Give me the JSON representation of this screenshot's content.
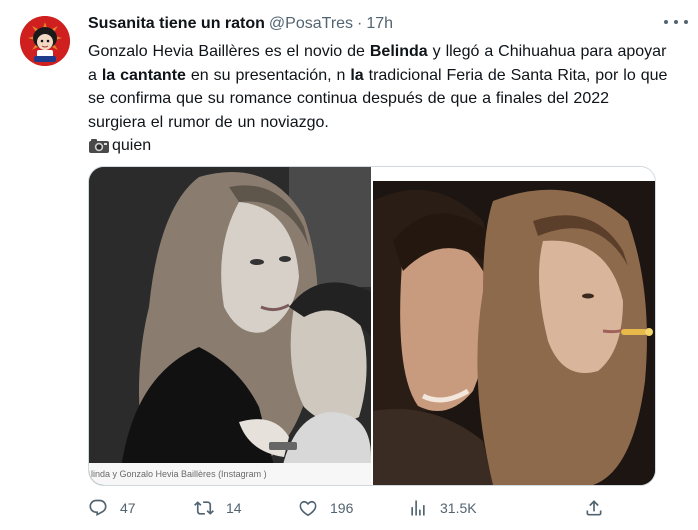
{
  "tweet": {
    "author_name": "Susanita tiene un raton",
    "handle": "@PosaTres",
    "separator": "·",
    "time": "17h",
    "text_parts": [
      {
        "t": "Gonzalo Hevia Baillères es  el novio de ",
        "b": false
      },
      {
        "t": "Belinda",
        "b": true
      },
      {
        "t": " y llegó a Chihuahua  para apoyar a ",
        "b": false
      },
      {
        "t": "la cantante",
        "b": true
      },
      {
        "t": " en su presentación, n ",
        "b": false
      },
      {
        "t": "la",
        "b": true
      },
      {
        "t": " tradicional Feria de Santa Rita, por lo que se confirma que su romance continua después de que a finales del 2022 surgiera el rumor de un noviazgo.",
        "b": false
      }
    ],
    "credit": "quien",
    "photo_caption": "linda y Gonzalo Hevia Baillères  (Instagram )",
    "actions": {
      "replies": "47",
      "retweets": "14",
      "likes": "196",
      "views": "31.5K"
    }
  },
  "colors": {
    "text": "#0f1419",
    "muted": "#536471",
    "avatar_bg": "#d01f1f"
  },
  "icons": [
    "more-icon",
    "camera-icon",
    "reply-icon",
    "retweet-icon",
    "like-icon",
    "views-icon",
    "share-icon"
  ]
}
